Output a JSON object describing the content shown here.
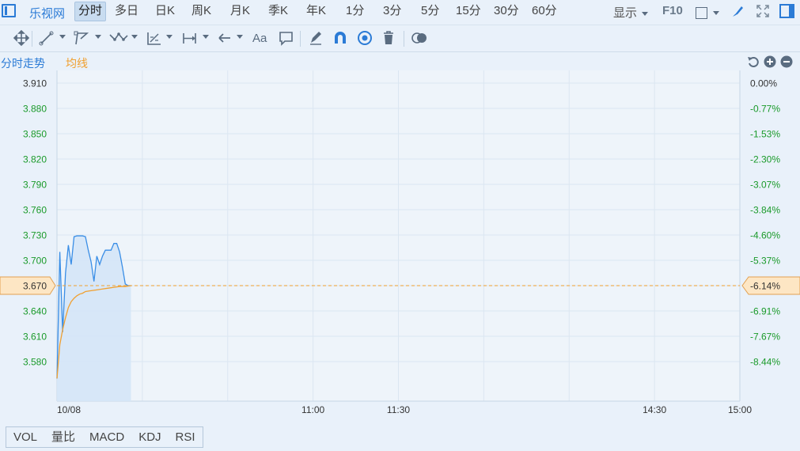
{
  "topbar": {
    "stock_name": "乐视网",
    "periods": [
      "分时",
      "多日",
      "日K",
      "周K",
      "月K",
      "季K",
      "年K",
      "1分",
      "3分",
      "5分",
      "15分",
      "30分",
      "60分"
    ],
    "active_period": "分时",
    "display_label": "显示",
    "f10_label": "F10"
  },
  "toolbar": {
    "text_tool_label": "Aa"
  },
  "chart_header": {
    "title": "分时走势",
    "avg_label": "均线"
  },
  "colors": {
    "price_line": "#3a8ee6",
    "avg_line": "#f0a030",
    "axis_green": "#1a9a2a",
    "ref_line": "#f0a030",
    "marker_fill": "#fde6c4"
  },
  "chart_data": {
    "type": "line",
    "prev_close": 3.91,
    "current_price": 3.67,
    "current_change_pct": "-6.14%",
    "ylim": [
      3.555,
      3.925
    ],
    "y_ticks": [
      "3.910",
      "3.880",
      "3.850",
      "3.820",
      "3.790",
      "3.760",
      "3.730",
      "3.700",
      "3.670",
      "3.640",
      "3.610",
      "3.580"
    ],
    "y_tick_values": [
      3.91,
      3.88,
      3.85,
      3.82,
      3.79,
      3.76,
      3.73,
      3.7,
      3.67,
      3.64,
      3.61,
      3.58
    ],
    "pct_ticks": [
      "0.00%",
      "-0.77%",
      "-1.53%",
      "-2.30%",
      "-3.07%",
      "-3.84%",
      "-4.60%",
      "-5.37%",
      "-6.14%",
      "-6.91%",
      "-7.67%",
      "-8.44%"
    ],
    "x_labels": [
      {
        "label": "10/08",
        "minute": 0
      },
      {
        "label": "11:00",
        "minute": 90
      },
      {
        "label": "11:30",
        "minute": 120
      },
      {
        "label": "14:30",
        "minute": 210
      },
      {
        "label": "15:00",
        "minute": 240
      }
    ],
    "total_minutes": 240,
    "series": [
      {
        "name": "分时走势",
        "x": [
          0,
          1,
          2,
          3,
          4,
          5,
          6,
          7,
          8,
          9,
          10,
          11,
          12,
          13,
          14,
          15,
          16,
          17,
          18,
          19,
          20,
          21,
          22,
          23,
          24,
          25,
          26
        ],
        "values": [
          3.56,
          3.71,
          3.615,
          3.685,
          3.718,
          3.695,
          3.728,
          3.729,
          3.729,
          3.729,
          3.728,
          3.712,
          3.698,
          3.675,
          3.705,
          3.695,
          3.705,
          3.712,
          3.712,
          3.712,
          3.72,
          3.72,
          3.71,
          3.692,
          3.672,
          3.67,
          3.67
        ]
      },
      {
        "name": "均线",
        "x": [
          0,
          1,
          2,
          3,
          4,
          5,
          6,
          7,
          8,
          9,
          10,
          12,
          14,
          16,
          18,
          20,
          22,
          24,
          26
        ],
        "values": [
          3.56,
          3.6,
          3.618,
          3.632,
          3.644,
          3.651,
          3.655,
          3.658,
          3.66,
          3.661,
          3.663,
          3.664,
          3.665,
          3.666,
          3.667,
          3.668,
          3.669,
          3.669,
          3.67
        ]
      }
    ]
  },
  "indicators": [
    "VOL",
    "量比",
    "MACD",
    "KDJ",
    "RSI"
  ]
}
